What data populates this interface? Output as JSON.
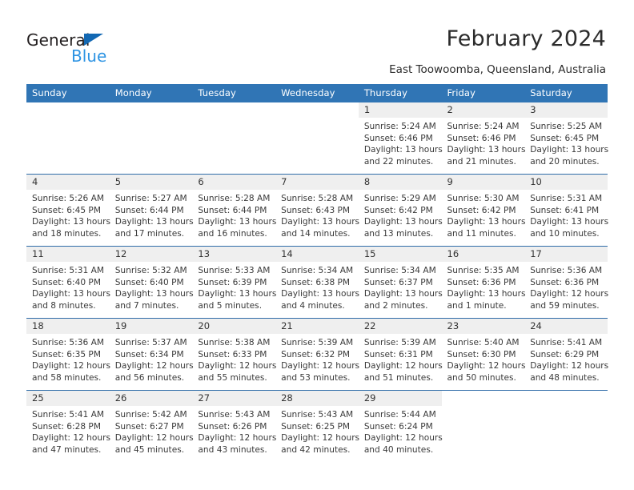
{
  "brand": {
    "name_part1": "General",
    "name_part2": "Blue",
    "triangle_color": "#1268b3",
    "blue_color": "#2e94e3"
  },
  "header": {
    "title": "February 2024",
    "subtitle": "East Toowoomba, Queensland, Australia",
    "header_bg_color": "#3075b5",
    "daynum_bg_color": "#efefef"
  },
  "weekdays": [
    "Sunday",
    "Monday",
    "Tuesday",
    "Wednesday",
    "Thursday",
    "Friday",
    "Saturday"
  ],
  "weeks": [
    [
      {
        "day": "",
        "blank": true,
        "l1": "",
        "l2": "",
        "l3": "",
        "l4": ""
      },
      {
        "day": "",
        "blank": true,
        "l1": "",
        "l2": "",
        "l3": "",
        "l4": ""
      },
      {
        "day": "",
        "blank": true,
        "l1": "",
        "l2": "",
        "l3": "",
        "l4": ""
      },
      {
        "day": "",
        "blank": true,
        "l1": "",
        "l2": "",
        "l3": "",
        "l4": ""
      },
      {
        "day": "1",
        "l1": "Sunrise: 5:24 AM",
        "l2": "Sunset: 6:46 PM",
        "l3": "Daylight: 13 hours",
        "l4": "and 22 minutes."
      },
      {
        "day": "2",
        "l1": "Sunrise: 5:24 AM",
        "l2": "Sunset: 6:46 PM",
        "l3": "Daylight: 13 hours",
        "l4": "and 21 minutes."
      },
      {
        "day": "3",
        "l1": "Sunrise: 5:25 AM",
        "l2": "Sunset: 6:45 PM",
        "l3": "Daylight: 13 hours",
        "l4": "and 20 minutes."
      }
    ],
    [
      {
        "day": "4",
        "l1": "Sunrise: 5:26 AM",
        "l2": "Sunset: 6:45 PM",
        "l3": "Daylight: 13 hours",
        "l4": "and 18 minutes."
      },
      {
        "day": "5",
        "l1": "Sunrise: 5:27 AM",
        "l2": "Sunset: 6:44 PM",
        "l3": "Daylight: 13 hours",
        "l4": "and 17 minutes."
      },
      {
        "day": "6",
        "l1": "Sunrise: 5:28 AM",
        "l2": "Sunset: 6:44 PM",
        "l3": "Daylight: 13 hours",
        "l4": "and 16 minutes."
      },
      {
        "day": "7",
        "l1": "Sunrise: 5:28 AM",
        "l2": "Sunset: 6:43 PM",
        "l3": "Daylight: 13 hours",
        "l4": "and 14 minutes."
      },
      {
        "day": "8",
        "l1": "Sunrise: 5:29 AM",
        "l2": "Sunset: 6:42 PM",
        "l3": "Daylight: 13 hours",
        "l4": "and 13 minutes."
      },
      {
        "day": "9",
        "l1": "Sunrise: 5:30 AM",
        "l2": "Sunset: 6:42 PM",
        "l3": "Daylight: 13 hours",
        "l4": "and 11 minutes."
      },
      {
        "day": "10",
        "l1": "Sunrise: 5:31 AM",
        "l2": "Sunset: 6:41 PM",
        "l3": "Daylight: 13 hours",
        "l4": "and 10 minutes."
      }
    ],
    [
      {
        "day": "11",
        "l1": "Sunrise: 5:31 AM",
        "l2": "Sunset: 6:40 PM",
        "l3": "Daylight: 13 hours",
        "l4": "and 8 minutes."
      },
      {
        "day": "12",
        "l1": "Sunrise: 5:32 AM",
        "l2": "Sunset: 6:40 PM",
        "l3": "Daylight: 13 hours",
        "l4": "and 7 minutes."
      },
      {
        "day": "13",
        "l1": "Sunrise: 5:33 AM",
        "l2": "Sunset: 6:39 PM",
        "l3": "Daylight: 13 hours",
        "l4": "and 5 minutes."
      },
      {
        "day": "14",
        "l1": "Sunrise: 5:34 AM",
        "l2": "Sunset: 6:38 PM",
        "l3": "Daylight: 13 hours",
        "l4": "and 4 minutes."
      },
      {
        "day": "15",
        "l1": "Sunrise: 5:34 AM",
        "l2": "Sunset: 6:37 PM",
        "l3": "Daylight: 13 hours",
        "l4": "and 2 minutes."
      },
      {
        "day": "16",
        "l1": "Sunrise: 5:35 AM",
        "l2": "Sunset: 6:36 PM",
        "l3": "Daylight: 13 hours",
        "l4": "and 1 minute."
      },
      {
        "day": "17",
        "l1": "Sunrise: 5:36 AM",
        "l2": "Sunset: 6:36 PM",
        "l3": "Daylight: 12 hours",
        "l4": "and 59 minutes."
      }
    ],
    [
      {
        "day": "18",
        "l1": "Sunrise: 5:36 AM",
        "l2": "Sunset: 6:35 PM",
        "l3": "Daylight: 12 hours",
        "l4": "and 58 minutes."
      },
      {
        "day": "19",
        "l1": "Sunrise: 5:37 AM",
        "l2": "Sunset: 6:34 PM",
        "l3": "Daylight: 12 hours",
        "l4": "and 56 minutes."
      },
      {
        "day": "20",
        "l1": "Sunrise: 5:38 AM",
        "l2": "Sunset: 6:33 PM",
        "l3": "Daylight: 12 hours",
        "l4": "and 55 minutes."
      },
      {
        "day": "21",
        "l1": "Sunrise: 5:39 AM",
        "l2": "Sunset: 6:32 PM",
        "l3": "Daylight: 12 hours",
        "l4": "and 53 minutes."
      },
      {
        "day": "22",
        "l1": "Sunrise: 5:39 AM",
        "l2": "Sunset: 6:31 PM",
        "l3": "Daylight: 12 hours",
        "l4": "and 51 minutes."
      },
      {
        "day": "23",
        "l1": "Sunrise: 5:40 AM",
        "l2": "Sunset: 6:30 PM",
        "l3": "Daylight: 12 hours",
        "l4": "and 50 minutes."
      },
      {
        "day": "24",
        "l1": "Sunrise: 5:41 AM",
        "l2": "Sunset: 6:29 PM",
        "l3": "Daylight: 12 hours",
        "l4": "and 48 minutes."
      }
    ],
    [
      {
        "day": "25",
        "l1": "Sunrise: 5:41 AM",
        "l2": "Sunset: 6:28 PM",
        "l3": "Daylight: 12 hours",
        "l4": "and 47 minutes."
      },
      {
        "day": "26",
        "l1": "Sunrise: 5:42 AM",
        "l2": "Sunset: 6:27 PM",
        "l3": "Daylight: 12 hours",
        "l4": "and 45 minutes."
      },
      {
        "day": "27",
        "l1": "Sunrise: 5:43 AM",
        "l2": "Sunset: 6:26 PM",
        "l3": "Daylight: 12 hours",
        "l4": "and 43 minutes."
      },
      {
        "day": "28",
        "l1": "Sunrise: 5:43 AM",
        "l2": "Sunset: 6:25 PM",
        "l3": "Daylight: 12 hours",
        "l4": "and 42 minutes."
      },
      {
        "day": "29",
        "l1": "Sunrise: 5:44 AM",
        "l2": "Sunset: 6:24 PM",
        "l3": "Daylight: 12 hours",
        "l4": "and 40 minutes."
      },
      {
        "day": "",
        "blank": true,
        "l1": "",
        "l2": "",
        "l3": "",
        "l4": ""
      },
      {
        "day": "",
        "blank": true,
        "l1": "",
        "l2": "",
        "l3": "",
        "l4": ""
      }
    ]
  ]
}
